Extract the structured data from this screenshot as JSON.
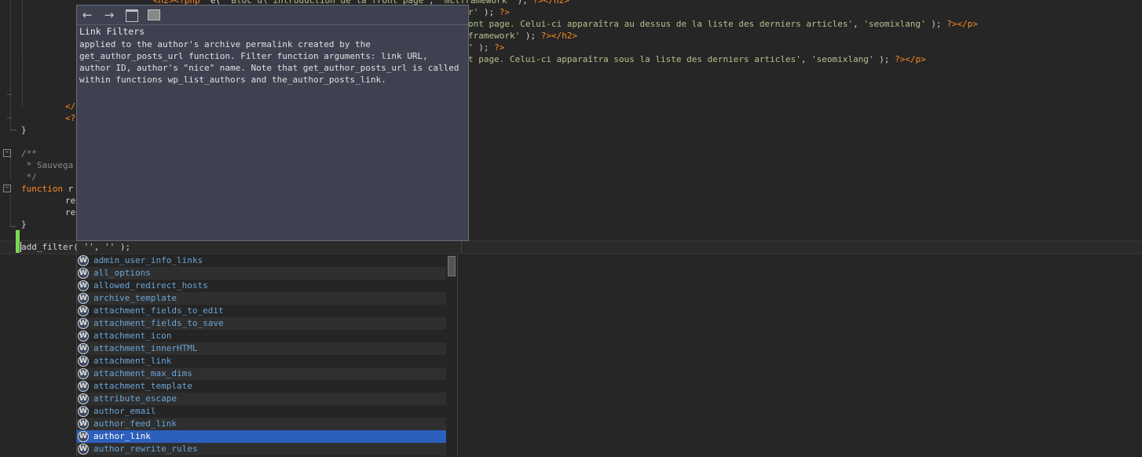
{
  "editor": {
    "right_lines": [
      {
        "parts": [
          {
            "c": "tag",
            "t": "<h2>"
          },
          {
            "c": "php",
            "t": "<?php"
          },
          {
            "c": "txt",
            "t": " _e( "
          },
          {
            "c": "str",
            "t": "'Bloc d\\'introduction de la front page'"
          },
          {
            "c": "txt",
            "t": ", "
          },
          {
            "c": "str",
            "t": "'mctframework'"
          },
          {
            "c": "txt",
            "t": " ); "
          },
          {
            "c": "php",
            "t": "?>"
          },
          {
            "c": "tag",
            "t": "</h2>"
          }
        ]
      },
      {
        "parts": [
          {
            "c": "str",
            "t": "r'"
          },
          {
            "c": "txt",
            "t": " ); "
          },
          {
            "c": "php",
            "t": "?>"
          }
        ]
      },
      {
        "parts": [
          {
            "c": "str",
            "t": "ont page. Celui-ci apparaîtra au dessus de la liste des derniers articles'"
          },
          {
            "c": "txt",
            "t": ", "
          },
          {
            "c": "str",
            "t": "'seomixlang'"
          },
          {
            "c": "txt",
            "t": " ); "
          },
          {
            "c": "php",
            "t": "?>"
          },
          {
            "c": "tag",
            "t": "</p>"
          }
        ]
      },
      {
        "parts": [
          {
            "c": "str",
            "t": "framework'"
          },
          {
            "c": "txt",
            "t": " ); "
          },
          {
            "c": "php",
            "t": "?>"
          },
          {
            "c": "tag",
            "t": "</h2>"
          }
        ]
      },
      {
        "parts": [
          {
            "c": "txt",
            "t": "' ); "
          },
          {
            "c": "php",
            "t": "?>"
          }
        ]
      },
      {
        "parts": [
          {
            "c": "str",
            "t": "t page. Celui-ci apparaîtra sous la liste des derniers articles'"
          },
          {
            "c": "txt",
            "t": ", "
          },
          {
            "c": "str",
            "t": "'seomixlang'"
          },
          {
            "c": "txt",
            "t": " ); "
          },
          {
            "c": "php",
            "t": "?>"
          },
          {
            "c": "tag",
            "t": "</p>"
          }
        ]
      }
    ],
    "left_tag_1": "</",
    "left_tag_2": "<?",
    "close_brace_1": "}",
    "comment_open": "/**",
    "comment_line": " * Sauvega",
    "comment_close": " */",
    "function_kw": "function",
    "function_rest": " r",
    "re_1": "re",
    "re_2": "re",
    "close_brace_2": "}",
    "current_line": "add_filter( '', '' );"
  },
  "doc_popup": {
    "title": "Link Filters",
    "body": "applied to the author's archive permalink created by the get_author_posts_url function. Filter function arguments: link URL, author ID, author's \"nice\" name. Note that get_author_posts_url is called within functions wp_list_authors and the_author_posts_link.",
    "back_icon": "←",
    "forward_icon": "→"
  },
  "completion": {
    "icon_letter": "W",
    "selected_index": 14,
    "items": [
      "admin_user_info_links",
      "all_options",
      "allowed_redirect_hosts",
      "archive_template",
      "attachment_fields_to_edit",
      "attachment_fields_to_save",
      "attachment_icon",
      "attachment_innerHTML",
      "attachment_link",
      "attachment_max_dims",
      "attachment_template",
      "attribute_escape",
      "author_email",
      "author_feed_link",
      "author_link",
      "author_rewrite_rules"
    ]
  }
}
